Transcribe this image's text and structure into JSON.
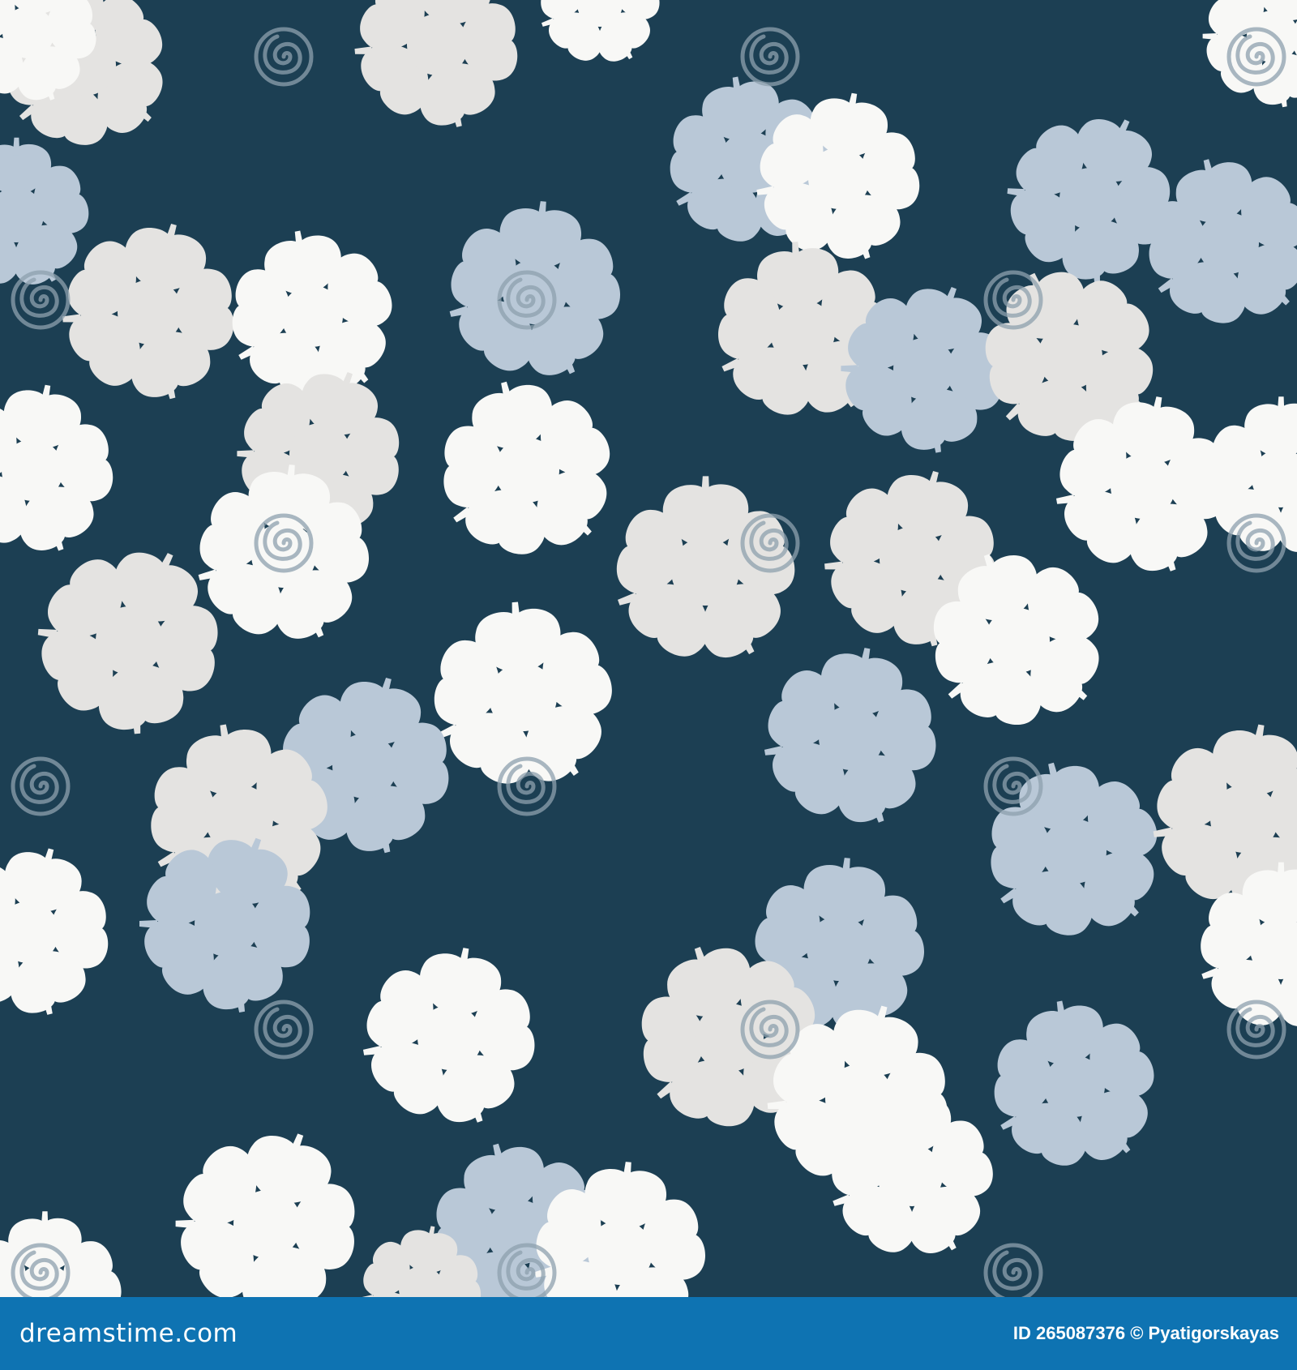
{
  "image": {
    "subject": "seamless floral pattern",
    "colors": {
      "background": "#1c3f53",
      "flower_white": "#f8f8f6",
      "flower_gray": "#e4e3e1",
      "flower_blue": "#b9c8d7",
      "watermark_tint": "#8ea1ae",
      "footer_bar": "#0e73b2"
    }
  },
  "watermark": {
    "text": "dreamstime",
    "icon": "spiral-logo-icon"
  },
  "footer": {
    "logo_text": "dreamstime.com",
    "id_text": "ID 265087376",
    "author_text": "© Pyatigorskayas"
  }
}
